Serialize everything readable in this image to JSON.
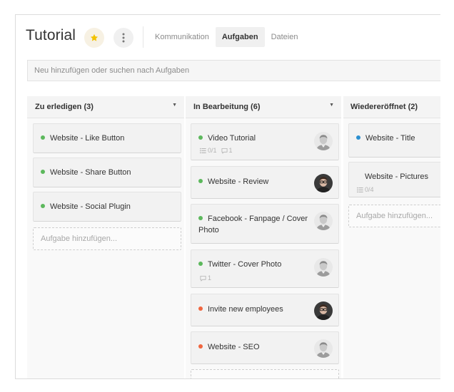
{
  "header": {
    "title": "Tutorial",
    "star_icon": "star-icon",
    "more_icon": "more-vertical-icon",
    "tabs": [
      {
        "label": "Kommunikation",
        "active": false
      },
      {
        "label": "Aufgaben",
        "active": true
      },
      {
        "label": "Dateien",
        "active": false
      }
    ]
  },
  "search": {
    "placeholder": "Neu hinzufügen oder suchen nach Aufgaben"
  },
  "colors": {
    "green": "#5cb85c",
    "red": "#f0663f",
    "blue": "#2b8fd0",
    "star": "#f2c200"
  },
  "columns": [
    {
      "title": "Zu erledigen (3)",
      "cards": [
        {
          "title": "Website - Like Button",
          "status": "green"
        },
        {
          "title": "Website - Share Button",
          "status": "green"
        },
        {
          "title": "Website - Social Plugin",
          "status": "green"
        }
      ],
      "add_label": "Aufgabe hinzufügen..."
    },
    {
      "title": "In Bearbeitung (6)",
      "cards": [
        {
          "title": "Video Tutorial",
          "status": "green",
          "checklist": "0/1",
          "comments": "1",
          "avatar": "avatar-light"
        },
        {
          "title": "Website - Review",
          "status": "green",
          "avatar": "avatar-dark"
        },
        {
          "title": "Facebook - Fanpage / Cover",
          "title_2": "Photo",
          "status": "green",
          "avatar": "avatar-light"
        },
        {
          "title": "Twitter - Cover Photo",
          "status": "green",
          "comments": "1",
          "avatar": "avatar-light"
        },
        {
          "title": "Invite new employees",
          "status": "red",
          "avatar": "avatar-dark"
        },
        {
          "title": "Website - SEO",
          "status": "red",
          "avatar": "avatar-light"
        }
      ]
    },
    {
      "title": "Wiedereröffnet (2)",
      "cards": [
        {
          "title": "Website - Title",
          "status": "blue"
        },
        {
          "title": "Website - Pictures",
          "checklist": "0/4"
        }
      ],
      "add_label": "Aufgabe hinzufügen..."
    }
  ]
}
